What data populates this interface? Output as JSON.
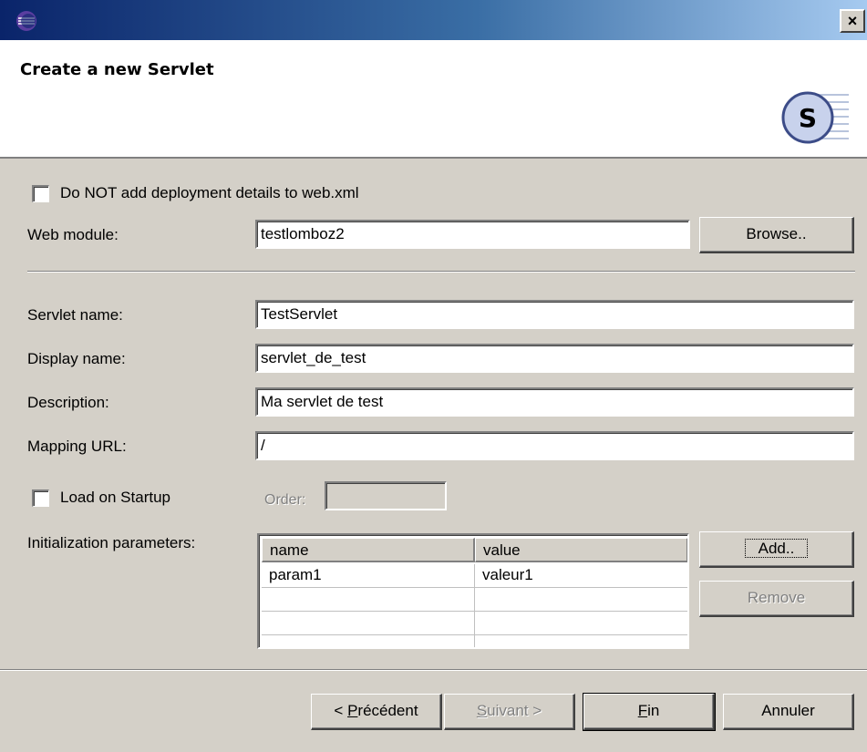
{
  "window": {
    "close_label": "×"
  },
  "banner": {
    "title": "Create a new Servlet",
    "icon_letter": "S"
  },
  "form": {
    "no_deploy_label": "Do NOT add deployment details to web.xml",
    "web_module_label": "Web module:",
    "web_module_value": "testlomboz2",
    "browse_label": "Browse..",
    "servlet_name_label": "Servlet name:",
    "servlet_name_value": "TestServlet",
    "display_name_label": "Display name:",
    "display_name_value": "servlet_de_test",
    "description_label": "Description:",
    "description_value": "Ma servlet de test",
    "mapping_url_label": "Mapping URL:",
    "mapping_url_value": "/",
    "load_on_startup_label": "Load on Startup",
    "order_label": "Order:",
    "order_value": "",
    "init_params_label": "Initialization parameters:",
    "add_label": "Add..",
    "remove_label": "Remove"
  },
  "table": {
    "columns": [
      "name",
      "value"
    ],
    "rows": [
      [
        "param1",
        "valeur1"
      ],
      [
        "",
        ""
      ],
      [
        "",
        ""
      ],
      [
        "",
        ""
      ]
    ]
  },
  "footer": {
    "prev_prefix": "< ",
    "prev_mnemonic": "P",
    "prev_rest": "récédent",
    "next_mnemonic": "S",
    "next_rest": "uivant >",
    "finish_mnemonic": "F",
    "finish_rest": "in",
    "cancel_label": "Annuler"
  }
}
